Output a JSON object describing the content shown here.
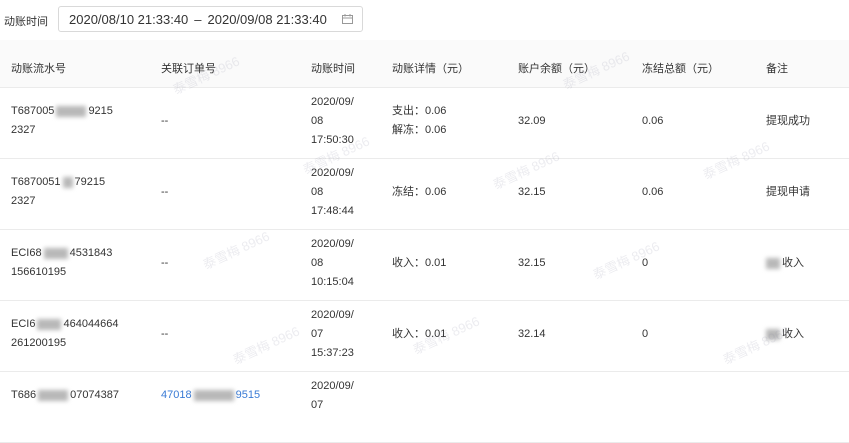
{
  "filter": {
    "label": "动账时间",
    "start": "2020/08/10 21:33:40",
    "separator": "–",
    "end": "2020/09/08 21:33:40",
    "icon": "calendar-icon"
  },
  "columns": [
    "动账流水号",
    "关联订单号",
    "动账时间",
    "动账详情（元）",
    "账户余额（元）",
    "冻结总额（元）",
    "备注"
  ],
  "rows": [
    {
      "serial_a": "T687005",
      "serial_b": "9215",
      "serial_c": "2327",
      "order": "--",
      "time": "2020/09/\n08\n17:50:30",
      "detail": "支出：0.06\n解冻：0.06",
      "balance": "32.09",
      "frozen": "0.06",
      "remark": "提现成功"
    },
    {
      "serial_a": "T6870051",
      "serial_b": "79215",
      "serial_c": "2327",
      "order": "--",
      "time": "2020/09/\n08\n17:48:44",
      "detail": "冻结：0.06",
      "balance": "32.15",
      "frozen": "0.06",
      "remark": "提现申请"
    },
    {
      "serial_a": "ECI68",
      "serial_b": "4531843",
      "serial_c": "156610195",
      "order": "--",
      "time": "2020/09/\n08\n10:15:04",
      "detail": "收入：0.01",
      "balance": "32.15",
      "frozen": "0",
      "remark": "收入"
    },
    {
      "serial_a": "ECI6",
      "serial_b": "464044664",
      "serial_c": "261200195",
      "order": "--",
      "time": "2020/09/\n07\n15:37:23",
      "detail": "收入：0.01",
      "balance": "32.14",
      "frozen": "0",
      "remark": "收入"
    },
    {
      "serial_a": "T686",
      "serial_b": "07074387",
      "serial_c": "",
      "order_a": "47018",
      "order_b": "9515",
      "time": "2020/09/\n07"
    }
  ],
  "watermark": "泰雪梅 8966"
}
